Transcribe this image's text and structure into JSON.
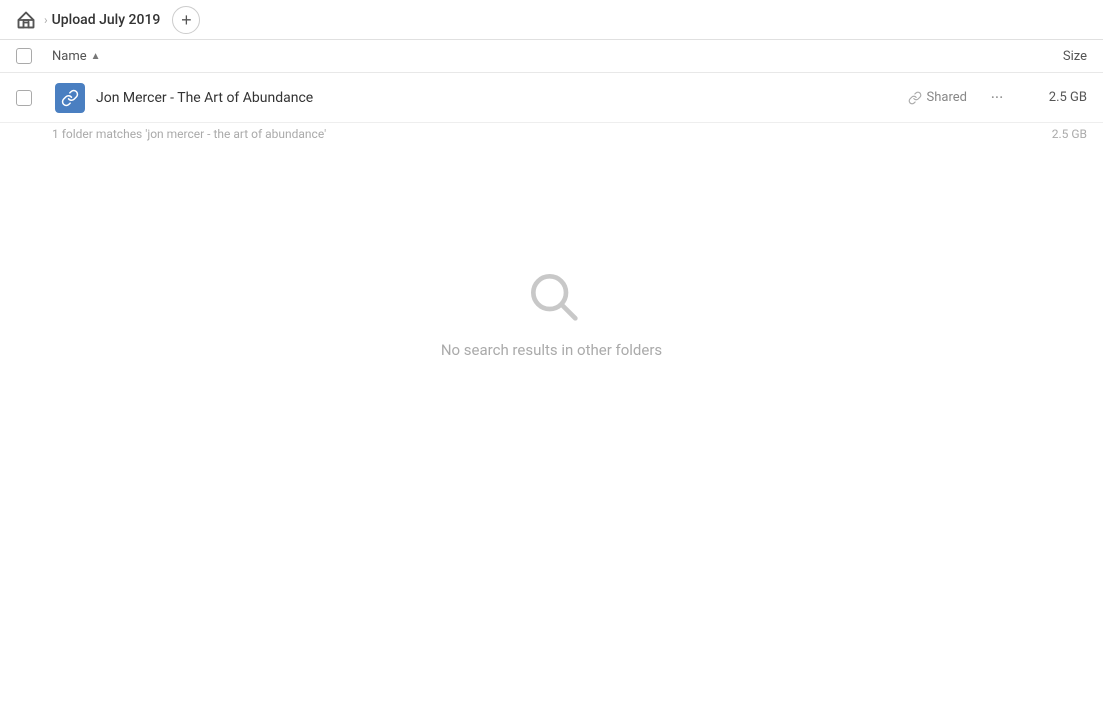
{
  "header": {
    "home_icon": "home-icon",
    "breadcrumb_label": "Upload July 2019",
    "add_button_label": "+"
  },
  "columns": {
    "name_label": "Name",
    "sort_arrow": "▲",
    "size_label": "Size"
  },
  "file_row": {
    "folder_icon": "folder-icon",
    "name": "Jon Mercer - The Art of Abundance",
    "shared_icon": "link-icon",
    "shared_label": "Shared",
    "more_icon": "···",
    "size": "2.5 GB"
  },
  "match_row": {
    "text": "1 folder matches 'jon mercer - the art of abundance'",
    "size": "2.5 GB"
  },
  "empty_state": {
    "icon": "search-icon",
    "message": "No search results in other folders"
  }
}
